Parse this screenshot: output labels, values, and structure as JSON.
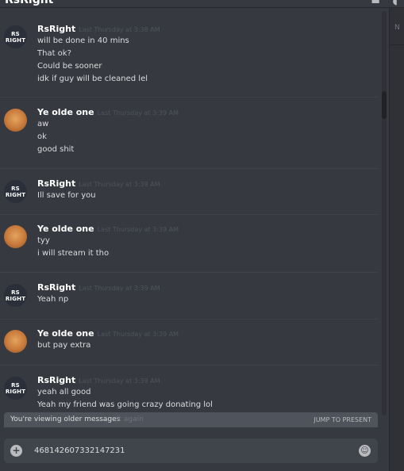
{
  "header": {
    "title": "RsRight",
    "icon_pin": "pin-icon",
    "icon_members": "members-icon"
  },
  "avatars": {
    "rsright_top": "RS",
    "rsright_bottom": "RIGHT"
  },
  "messages": [
    {
      "author": "RsRight",
      "timestamp": "Last Thursday at 3:38 AM",
      "lines": [
        "will be done in 40 mins",
        "That ok?",
        "Could be sooner",
        "idk if guy will be cleaned lel"
      ]
    },
    {
      "author": "Ye olde one",
      "timestamp": "Last Thursday at 3:39 AM",
      "lines": [
        "aw",
        "ok",
        "good shit"
      ]
    },
    {
      "author": "RsRight",
      "timestamp": "Last Thursday at 3:39 AM",
      "lines": [
        "Ill save for you"
      ]
    },
    {
      "author": "Ye olde one",
      "timestamp": "Last Thursday at 3:39 AM",
      "lines": [
        "tyy",
        "i will stream it tho"
      ]
    },
    {
      "author": "RsRight",
      "timestamp": "Last Thursday at 3:39 AM",
      "lines": [
        "Yeah np"
      ]
    },
    {
      "author": "Ye olde one",
      "timestamp": "Last Thursday at 3:39 AM",
      "lines": [
        "but pay extra"
      ]
    },
    {
      "author": "RsRight",
      "timestamp": "Last Thursday at 3:39 AM",
      "lines": [
        "yeah all good",
        "Yeah my friend was going crazy donating lol"
      ]
    }
  ],
  "older_bar": {
    "text": "You're viewing older messages",
    "ghost": "it again",
    "jump_label": "JUMP TO PRESENT"
  },
  "input": {
    "value": "468142607332147231"
  },
  "right_panel": {
    "letter": "N"
  },
  "colors": {
    "background": "#36393f",
    "input": "#40444b",
    "older_bar": "#4f545c",
    "text": "#dcddde",
    "author": "#ffffff",
    "timestamp": "#4f545c"
  }
}
